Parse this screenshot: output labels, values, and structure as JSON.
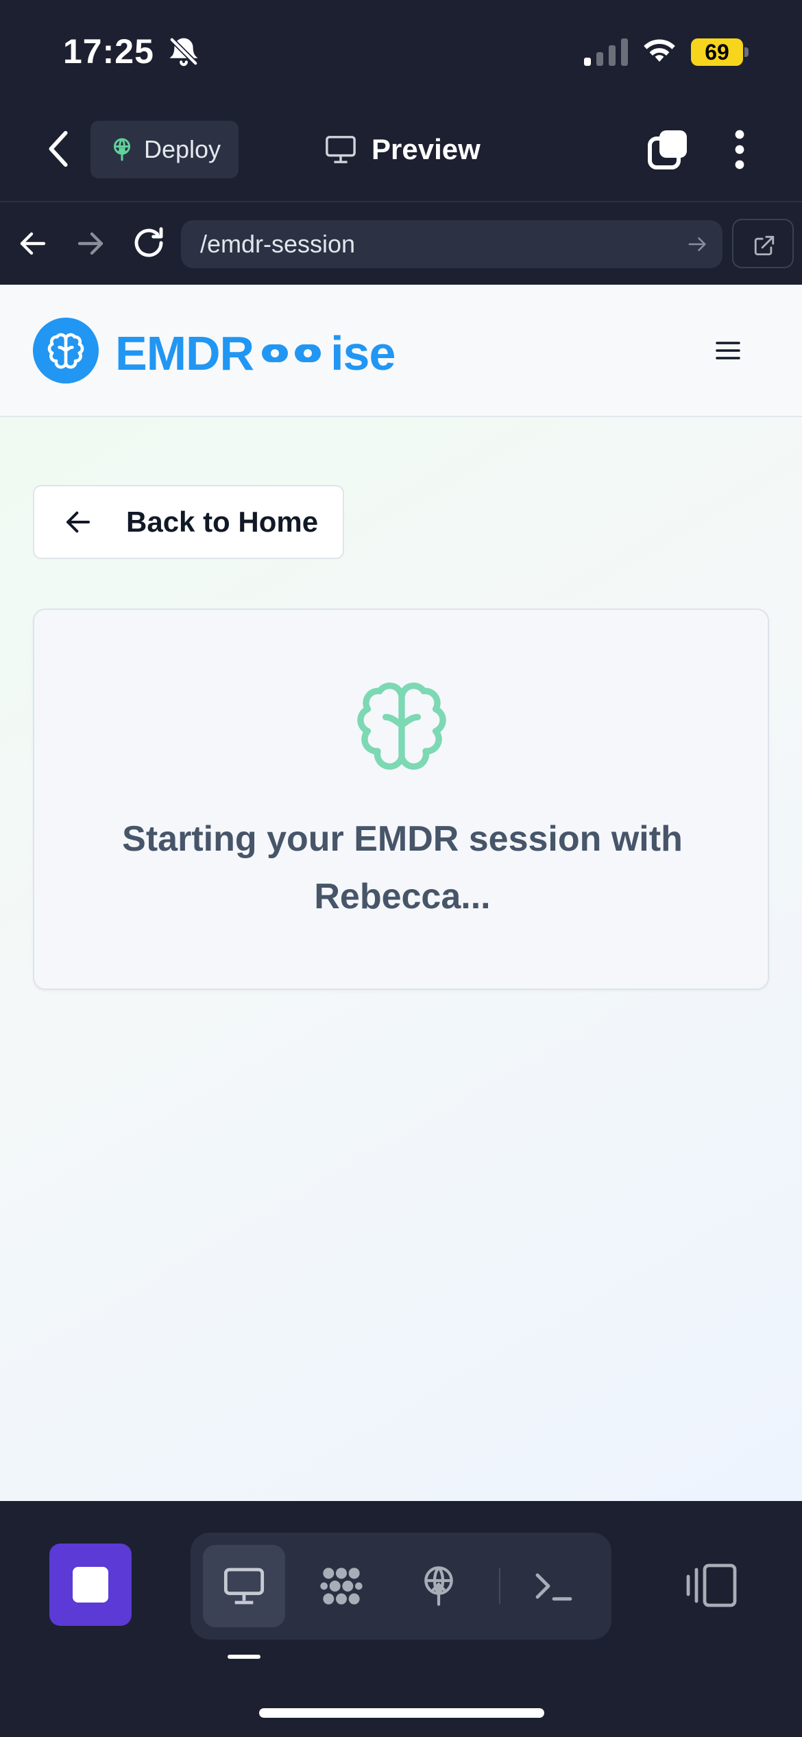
{
  "status_bar": {
    "time": "17:25",
    "battery": "69",
    "icons": [
      "bell-slash-icon",
      "cellular-signal-icon",
      "wifi-icon",
      "battery-icon"
    ]
  },
  "toolbar": {
    "deploy_label": "Deploy",
    "preview_label": "Preview",
    "icons": [
      "chevron-left-icon",
      "deploy-icon",
      "monitor-icon",
      "tabs-icon",
      "more-vertical-icon"
    ]
  },
  "browser": {
    "url": "/emdr-session",
    "icons": [
      "arrow-left-icon",
      "arrow-right-icon",
      "reload-icon",
      "go-arrow-icon",
      "external-link-icon"
    ]
  },
  "site": {
    "logo_text_start": "EMDR",
    "logo_text_end": "ise",
    "brand_color": "#2196f3",
    "accent_green": "#7dd8b4"
  },
  "main": {
    "back_button_label": "Back to Home",
    "session_message": "Starting your EMDR session with Rebecca..."
  },
  "dock": {
    "items": [
      "stop-icon",
      "monitor-icon",
      "apps-icon",
      "deploy-icon",
      "terminal-icon",
      "panel-toggle-icon"
    ],
    "active": "monitor-icon",
    "stop_color": "#5b3ad6"
  }
}
